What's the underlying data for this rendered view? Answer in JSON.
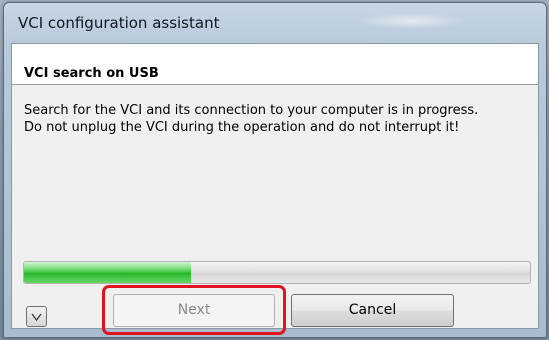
{
  "window": {
    "title": "VCI configuration assistant"
  },
  "header": {
    "title": "VCI search on USB"
  },
  "message": {
    "line1": "Search for the VCI and its connection to your computer is in progress.",
    "line2": "Do not unplug the VCI during the operation and do not interrupt it!"
  },
  "progress": {
    "value_percent": 33
  },
  "buttons": {
    "details_icon": "chevron-down-icon",
    "next_label": "Next",
    "next_enabled": false,
    "cancel_label": "Cancel"
  },
  "annotation": {
    "highlight_target": "next-button",
    "color": "#e0141e"
  },
  "colors": {
    "progress_green": "#2bb52b",
    "highlight_red": "#e0141e"
  }
}
